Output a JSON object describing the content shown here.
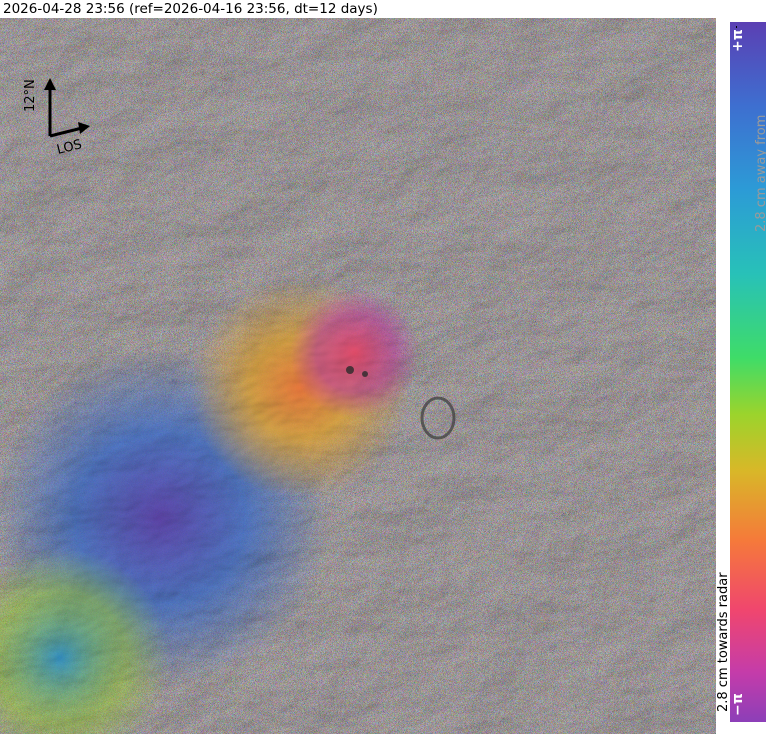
{
  "header": {
    "timestamp_text": "2026-04-28 23:56 (ref=2026-04-16 23:56, dt=12 days)"
  },
  "compass": {
    "north_label": "12°N",
    "los_label": "LOS"
  },
  "colorbar": {
    "top_label": "+π",
    "bottom_label": "−π",
    "away_label": "2.8 cm away from radar",
    "towards_label": "2.8 cm towards radar",
    "colors": [
      "#5b3fb3",
      "#3e6fd0",
      "#2c9bd6",
      "#28c1b8",
      "#3fdc68",
      "#9bd42c",
      "#d8b828",
      "#f57a3a",
      "#f0466e",
      "#c43caa",
      "#8c3fb8"
    ]
  }
}
